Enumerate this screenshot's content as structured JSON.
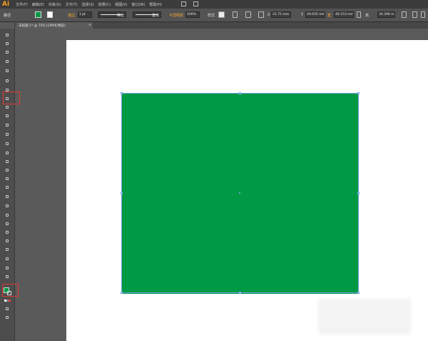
{
  "app": {
    "logo": "Ai"
  },
  "menus": [
    "文件(F)",
    "编辑(E)",
    "对象(O)",
    "文字(T)",
    "选择(S)",
    "效果(C)",
    "视图(V)",
    "窗口(W)",
    "帮助(H)"
  ],
  "control_bar": {
    "selection_label": "路径",
    "stroke_label": "描边",
    "stroke_weight": "1 pt",
    "stroke_style_label": "等比",
    "brush_label": "基本",
    "opacity_label": "不透明度",
    "opacity_value": "100%",
    "style_label": "样式",
    "x_label": "X",
    "x_value": "31.75 mm",
    "y_label": "Y",
    "y_value": "29.635 mm",
    "w_label": "宽",
    "w_value": "46.153 mm",
    "h_label": "高",
    "h_value": "34.396 mm"
  },
  "document_tab": {
    "title": "未标题-1* @ 75% (CMYK/预览)",
    "close": "×"
  },
  "canvas": {
    "fill_color": "#009944",
    "selection_color": "#6f9fe0",
    "highlight_color": "#e53935"
  }
}
